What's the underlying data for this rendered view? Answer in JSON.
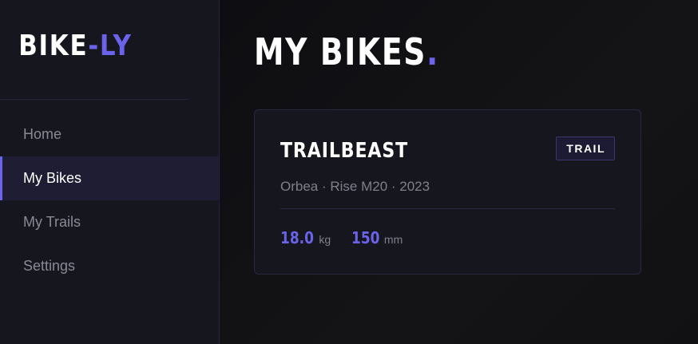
{
  "brand": {
    "part1": "BIKE",
    "part2": "-LY"
  },
  "sidebar": {
    "items": [
      {
        "label": "Home",
        "active": false
      },
      {
        "label": "My Bikes",
        "active": true
      },
      {
        "label": "My Trails",
        "active": false
      },
      {
        "label": "Settings",
        "active": false
      }
    ]
  },
  "main": {
    "title": "MY BIKES",
    "title_dot": "."
  },
  "bikes": [
    {
      "name": "TRAILBEAST",
      "type": "TRAIL",
      "meta": "Orbea · Rise M20 · 2023",
      "weight": {
        "value": "18.0",
        "unit": "kg"
      },
      "travel": {
        "value": "150",
        "unit": "mm"
      }
    }
  ],
  "colors": {
    "accent": "#6b63ea",
    "background": "#0f0f13",
    "sidebar": "#16161e",
    "card": "#16161e"
  }
}
